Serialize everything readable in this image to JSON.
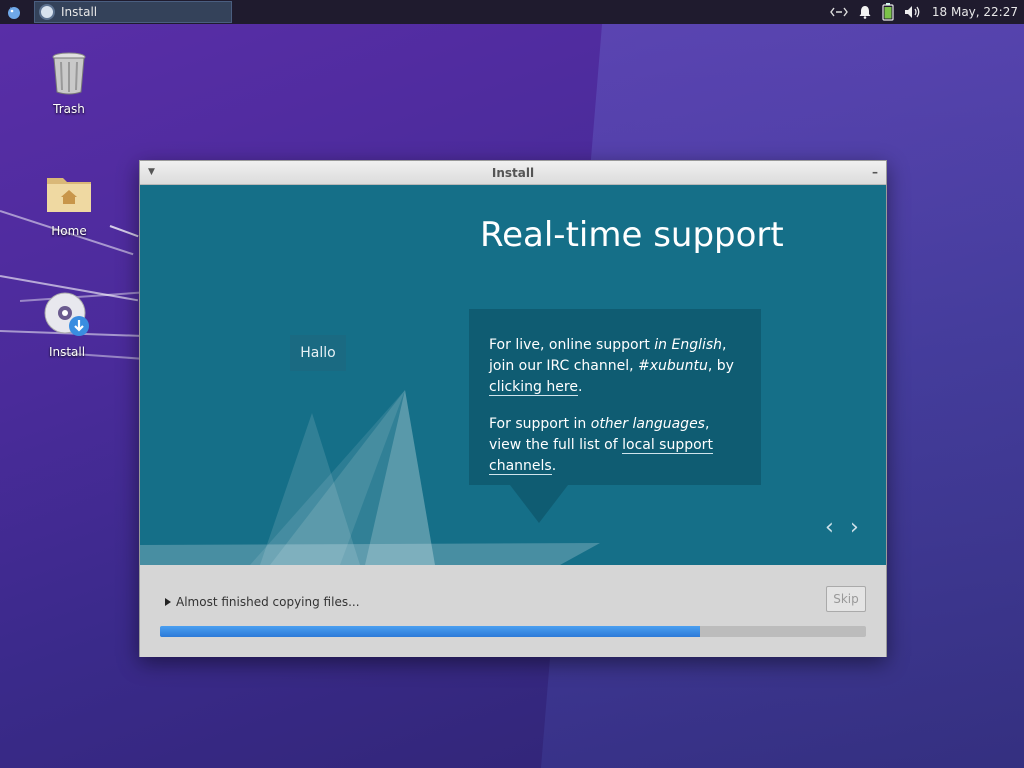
{
  "panel": {
    "task_label": "Install",
    "datetime": "18 May, 22:27",
    "icons": [
      "xfce-menu-icon",
      "network-icon",
      "notification-bell-icon",
      "battery-icon",
      "volume-icon"
    ]
  },
  "desktop": {
    "icons": [
      {
        "label": "Trash",
        "icon": "trash-icon"
      },
      {
        "label": "Home",
        "icon": "home-folder-icon"
      },
      {
        "label": "Install",
        "icon": "install-disc-icon"
      }
    ]
  },
  "window": {
    "title": "Install",
    "slide": {
      "title": "Real-time support",
      "hallo": "Hallo",
      "para1": {
        "pre": "For live, online support ",
        "em1": "in English",
        "mid": ", join our IRC channel, ",
        "em2": "#xubuntu",
        "post": ", by ",
        "link": "clicking here",
        "end": "."
      },
      "para2": {
        "pre": "For support in ",
        "em": "other languages",
        "mid": ", view the full list of ",
        "link": "local support channels",
        "end": "."
      },
      "nav_prev": "‹",
      "nav_next": "›"
    },
    "status": {
      "text": "Almost finished copying files...",
      "skip_label": "Skip",
      "progress": 0.765
    }
  },
  "colors": {
    "slide_bg": "#156f88",
    "bubble_bg": "#0f5c72",
    "progress": "#2c7ad8",
    "panel_bg": "#1f1b2e"
  }
}
